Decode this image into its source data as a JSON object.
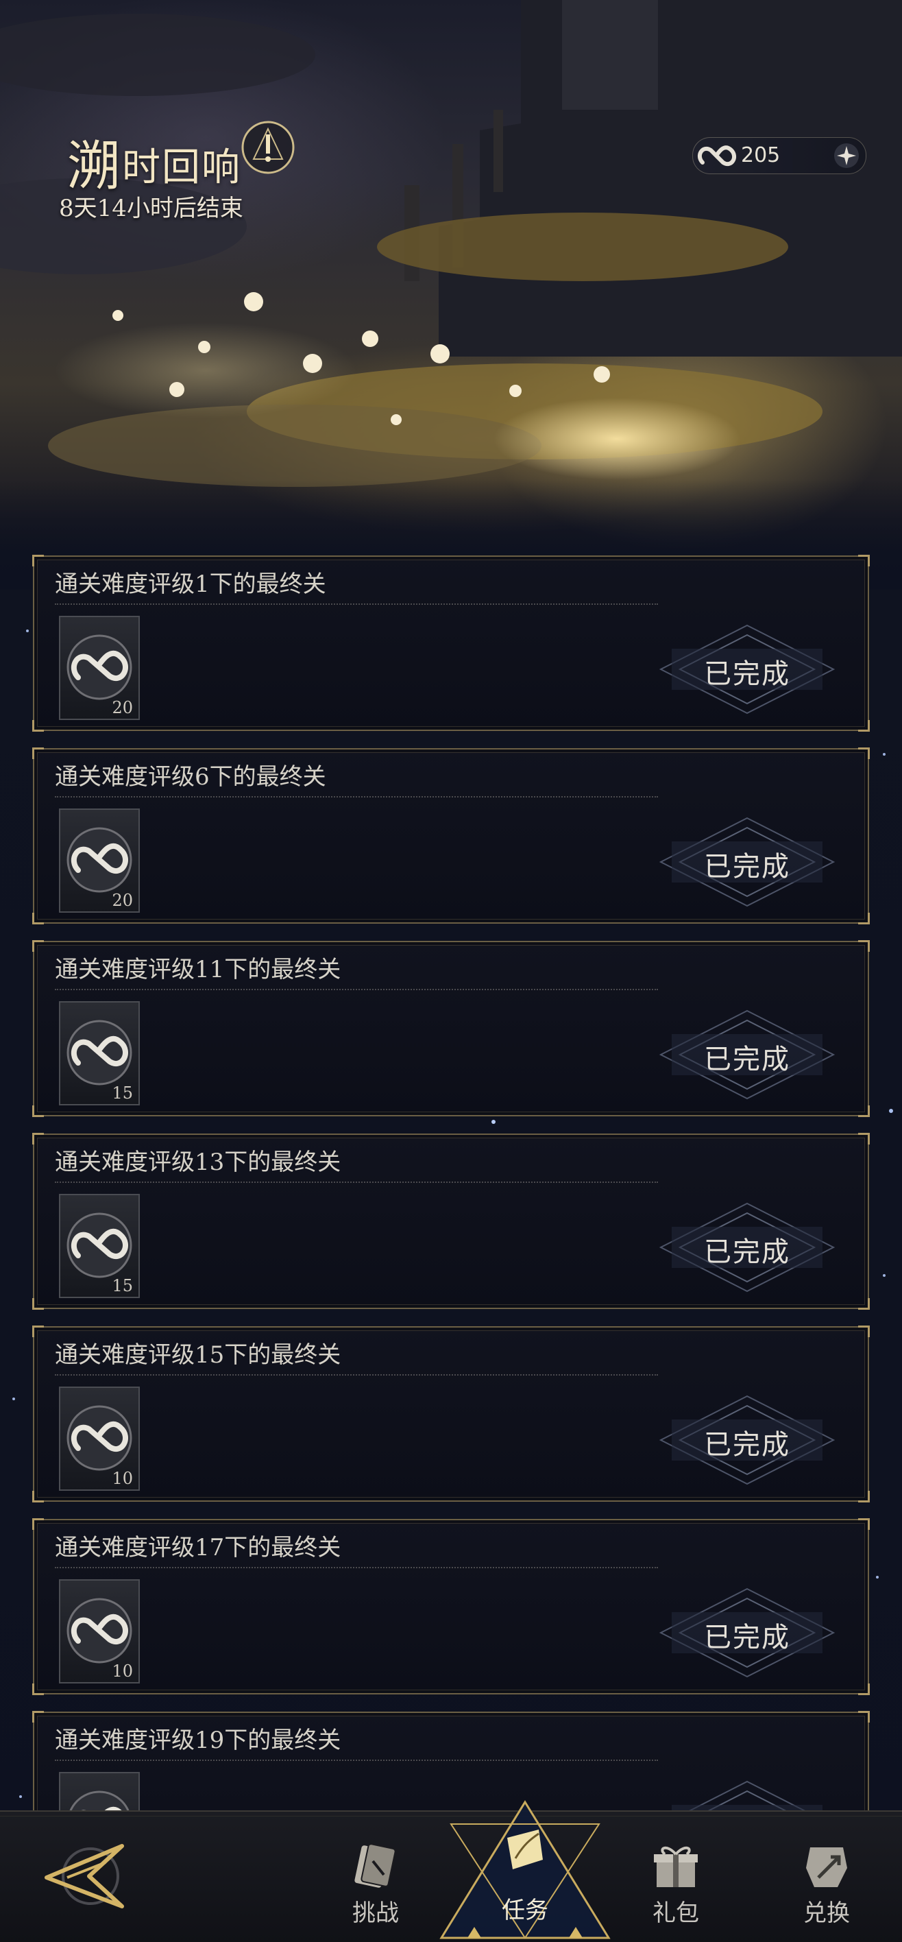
{
  "header": {
    "title_first": "溯",
    "title_rest": "时回响",
    "countdown": "8天14小时后结束"
  },
  "currency": {
    "icon": "infinity-token-icon",
    "amount": "205"
  },
  "tasks": [
    {
      "title": "通关难度评级1下的最终关",
      "reward_count": "20",
      "status": "已完成"
    },
    {
      "title": "通关难度评级6下的最终关",
      "reward_count": "20",
      "status": "已完成"
    },
    {
      "title": "通关难度评级11下的最终关",
      "reward_count": "15",
      "status": "已完成"
    },
    {
      "title": "通关难度评级13下的最终关",
      "reward_count": "15",
      "status": "已完成"
    },
    {
      "title": "通关难度评级15下的最终关",
      "reward_count": "10",
      "status": "已完成"
    },
    {
      "title": "通关难度评级17下的最终关",
      "reward_count": "10",
      "status": "已完成"
    },
    {
      "title": "通关难度评级19下的最终关",
      "reward_count": "",
      "status": ""
    }
  ],
  "nav": {
    "challenge": "挑战",
    "task": "任务",
    "gift": "礼包",
    "exchange": "兑换"
  },
  "colors": {
    "accent_gold": "#d7b766",
    "card_border": "#6b5f44",
    "background": "#0d1120"
  }
}
